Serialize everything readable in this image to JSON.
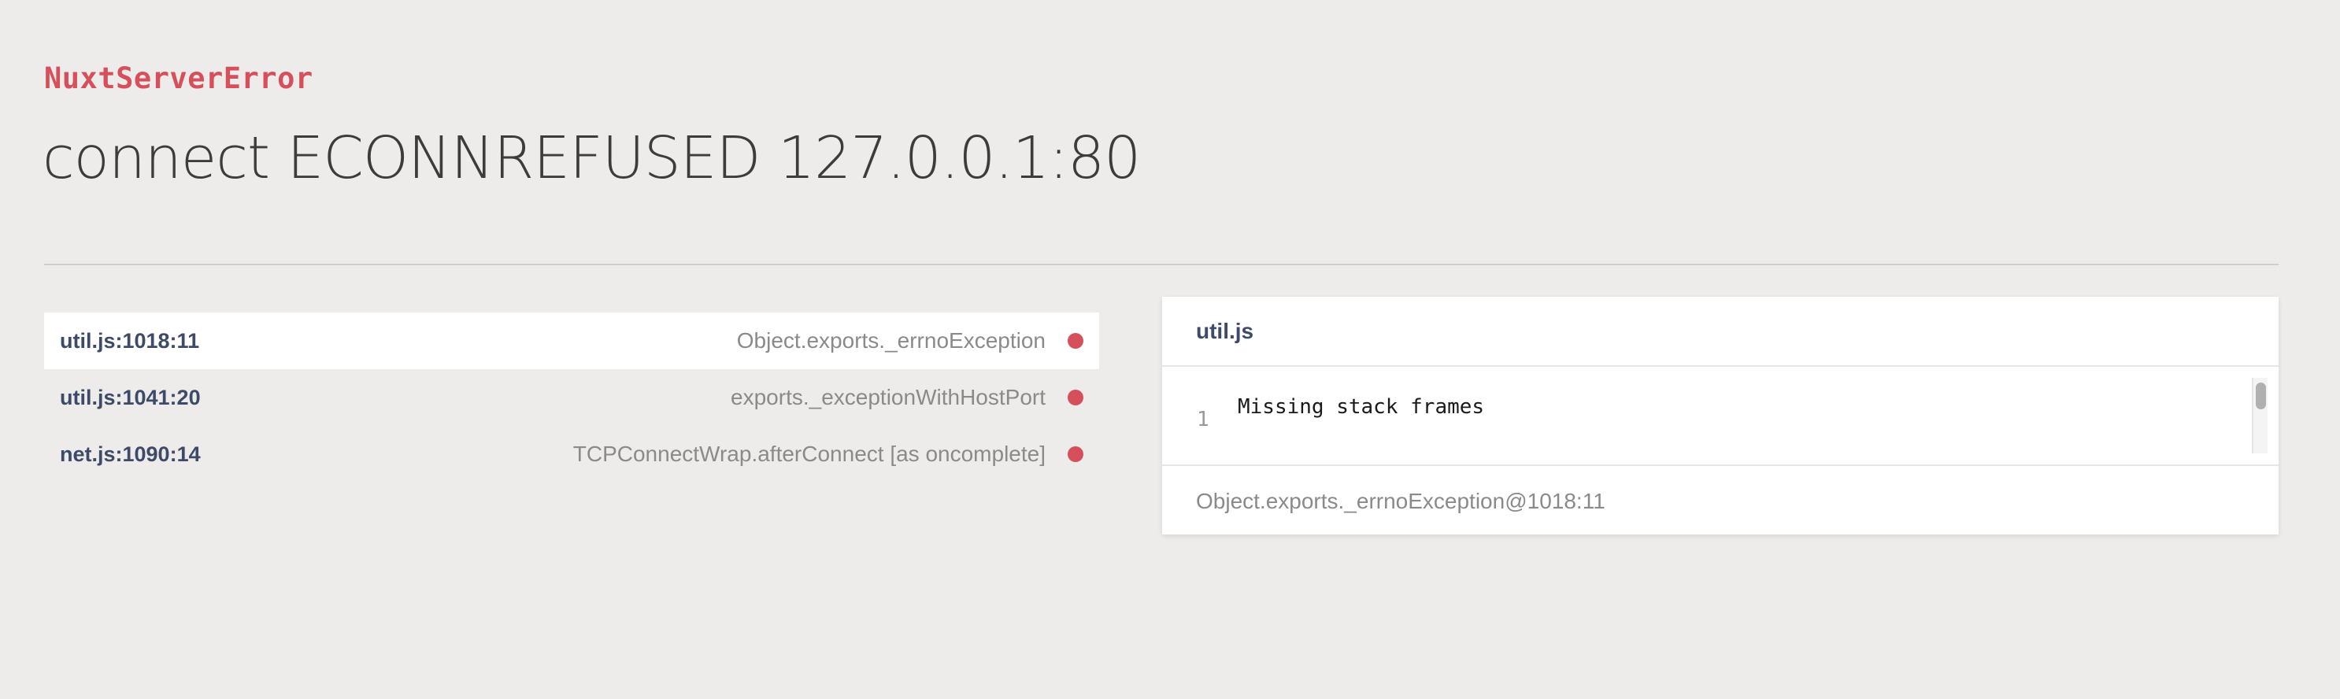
{
  "error": {
    "type": "NuxtServerError",
    "message": "connect ECONNREFUSED 127.0.0.1:80"
  },
  "frames": [
    {
      "location": "util.js:1018:11",
      "function": "Object.exports._errnoException",
      "active": true
    },
    {
      "location": "util.js:1041:20",
      "function": "exports._exceptionWithHostPort",
      "active": false
    },
    {
      "location": "net.js:1090:14",
      "function": "TCPConnectWrap.afterConnect [as oncomplete]",
      "active": false
    }
  ],
  "source": {
    "file": "util.js",
    "line_number": "1",
    "code": "Missing stack frames",
    "footer": "Object.exports._errnoException@1018:11"
  },
  "colors": {
    "accent": "#d6505c",
    "location_text": "#3d4a68",
    "background": "#edecea"
  }
}
